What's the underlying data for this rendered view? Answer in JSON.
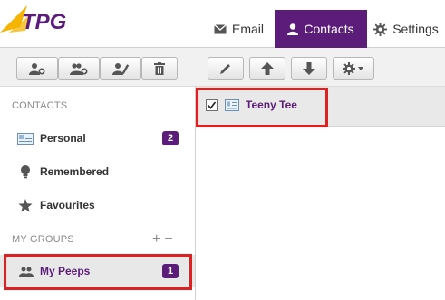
{
  "brand": {
    "logo_text": "TPG",
    "color": "#5c1d7a"
  },
  "nav": {
    "tabs": [
      {
        "label": "Email",
        "icon": "envelope-icon",
        "active": false
      },
      {
        "label": "Contacts",
        "icon": "person-icon",
        "active": true
      },
      {
        "label": "Settings",
        "icon": "gear-icon",
        "active": false
      }
    ]
  },
  "toolbar": {
    "left_group": [
      "add-contact-icon",
      "add-group-icon",
      "edit-contact-icon",
      "delete-icon"
    ],
    "right_group": [
      "pencil-icon",
      "arrow-up-icon",
      "arrow-down-icon",
      "gear-menu-icon"
    ]
  },
  "sidebar": {
    "contacts_header": "CONTACTS",
    "items": [
      {
        "label": "Personal",
        "icon": "address-book-icon",
        "count": "2"
      },
      {
        "label": "Remembered",
        "icon": "lightbulb-icon",
        "count": ""
      },
      {
        "label": "Favourites",
        "icon": "star-icon",
        "count": ""
      }
    ],
    "groups_header": "MY GROUPS",
    "group_add": "+",
    "group_remove": "−",
    "groups": [
      {
        "label": "My Peeps",
        "icon": "people-icon",
        "count": "1",
        "selected": true
      }
    ]
  },
  "contacts_list": {
    "rows": [
      {
        "name": "Teeny Tee",
        "checked": true,
        "icon": "vcard-icon"
      }
    ]
  },
  "colors": {
    "accent": "#5c1d7a",
    "highlight": "#e02020"
  }
}
